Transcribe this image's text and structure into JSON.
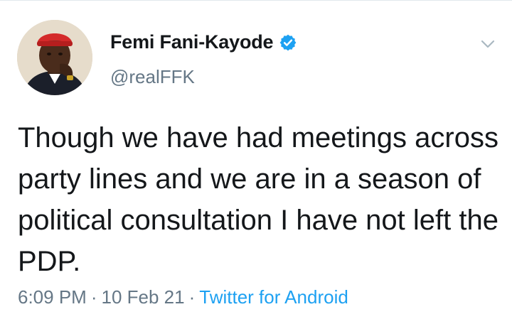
{
  "tweet": {
    "author": {
      "display_name": "Femi Fani-Kayode",
      "handle": "@realFFK",
      "verified": true,
      "avatar_icon": "profile-photo"
    },
    "text": "Though we have had meetings across party lines and we are in a season of political consultation I have not left the PDP.",
    "time": "6:09 PM",
    "date": "10 Feb 21",
    "separator": "·",
    "source": "Twitter for Android"
  },
  "colors": {
    "text_primary": "#14171a",
    "text_secondary": "#657786",
    "link_blue": "#1da1f2",
    "verified_blue": "#1da1f2",
    "divider": "#e1e8ed"
  },
  "icons": {
    "verified": "verified-badge-icon",
    "menu": "chevron-down-icon"
  }
}
